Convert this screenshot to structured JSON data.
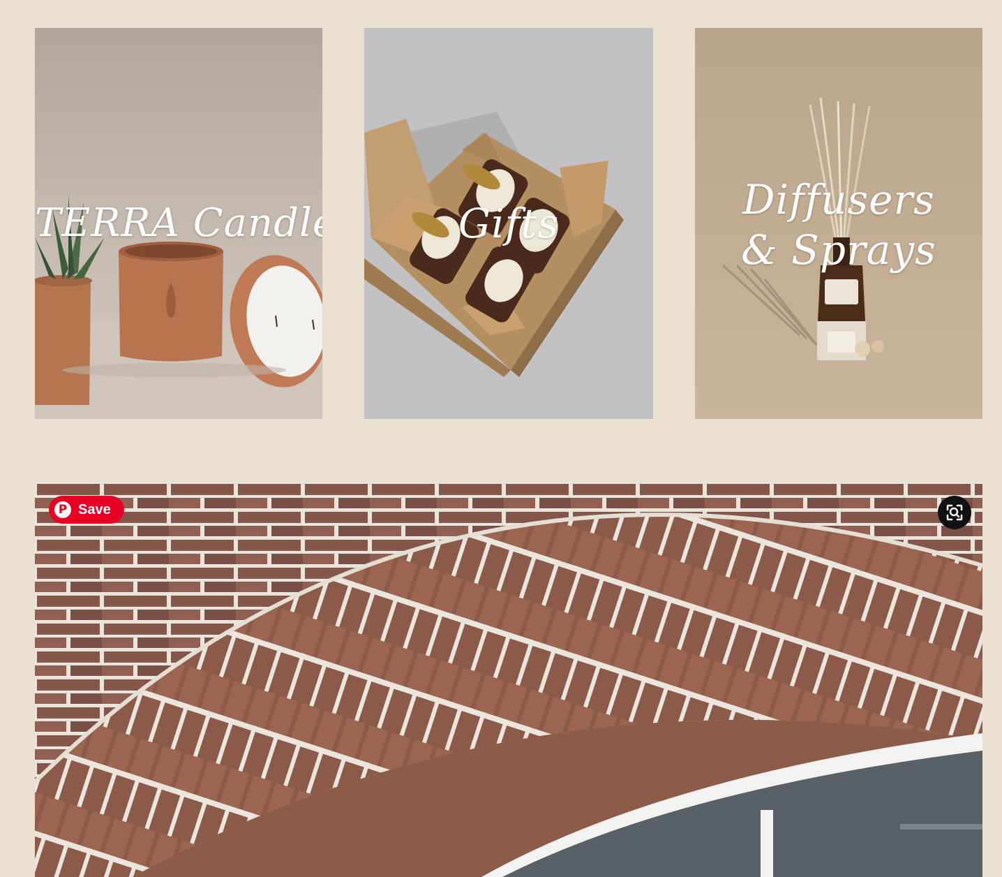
{
  "categories": [
    {
      "title": "TERRA Candles"
    },
    {
      "title": "Gifts"
    },
    {
      "title": "Diffusers & Sprays"
    }
  ],
  "pin_button": {
    "label": "Save",
    "icon": "pinterest-logo-icon",
    "color": "#e60023"
  },
  "visual_search": {
    "icon": "visual-search-icon"
  },
  "colors": {
    "background": "#e8dfd1",
    "tile_text": "#ffffff"
  }
}
